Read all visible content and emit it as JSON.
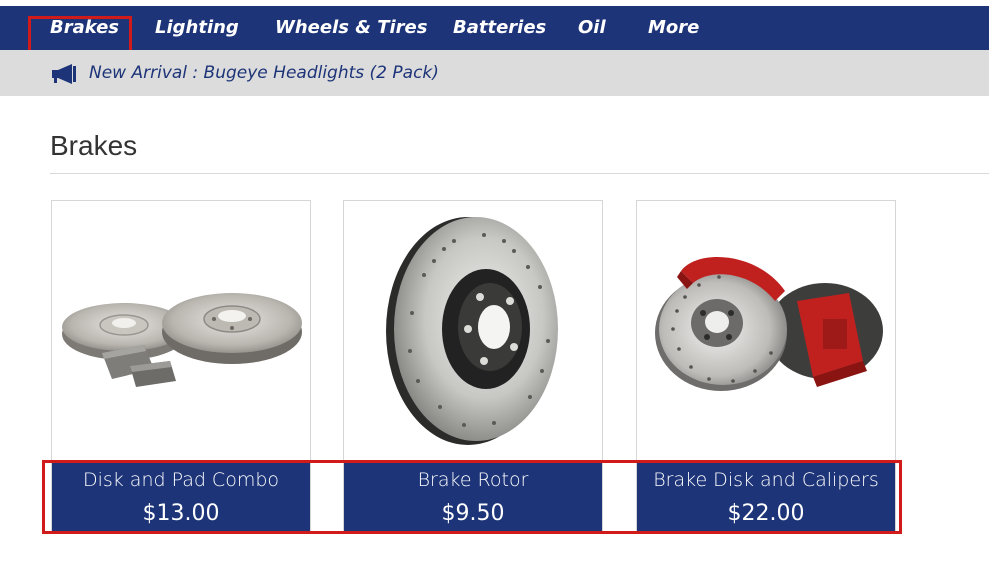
{
  "nav": {
    "items": [
      {
        "label": "Brakes"
      },
      {
        "label": "Lighting"
      },
      {
        "label": "Wheels & Tires"
      },
      {
        "label": "Batteries"
      },
      {
        "label": "Oil"
      },
      {
        "label": "More"
      }
    ]
  },
  "announcement": {
    "icon": "megaphone-icon",
    "text": "New Arrival : Bugeye Headlights (2 Pack)"
  },
  "section": {
    "title": "Brakes"
  },
  "products": [
    {
      "name": "Disk and Pad Combo",
      "price": "$13.00",
      "image": "brake-disk-and-pad-image"
    },
    {
      "name": "Brake Rotor",
      "price": "$9.50",
      "image": "brake-rotor-image"
    },
    {
      "name": "Brake Disk and Calipers",
      "price": "$22.00",
      "image": "brake-disk-calipers-image"
    }
  ],
  "colors": {
    "nav_bg": "#1d3478",
    "announce_bg": "#dcdcdc",
    "highlight": "#d11a1a"
  }
}
